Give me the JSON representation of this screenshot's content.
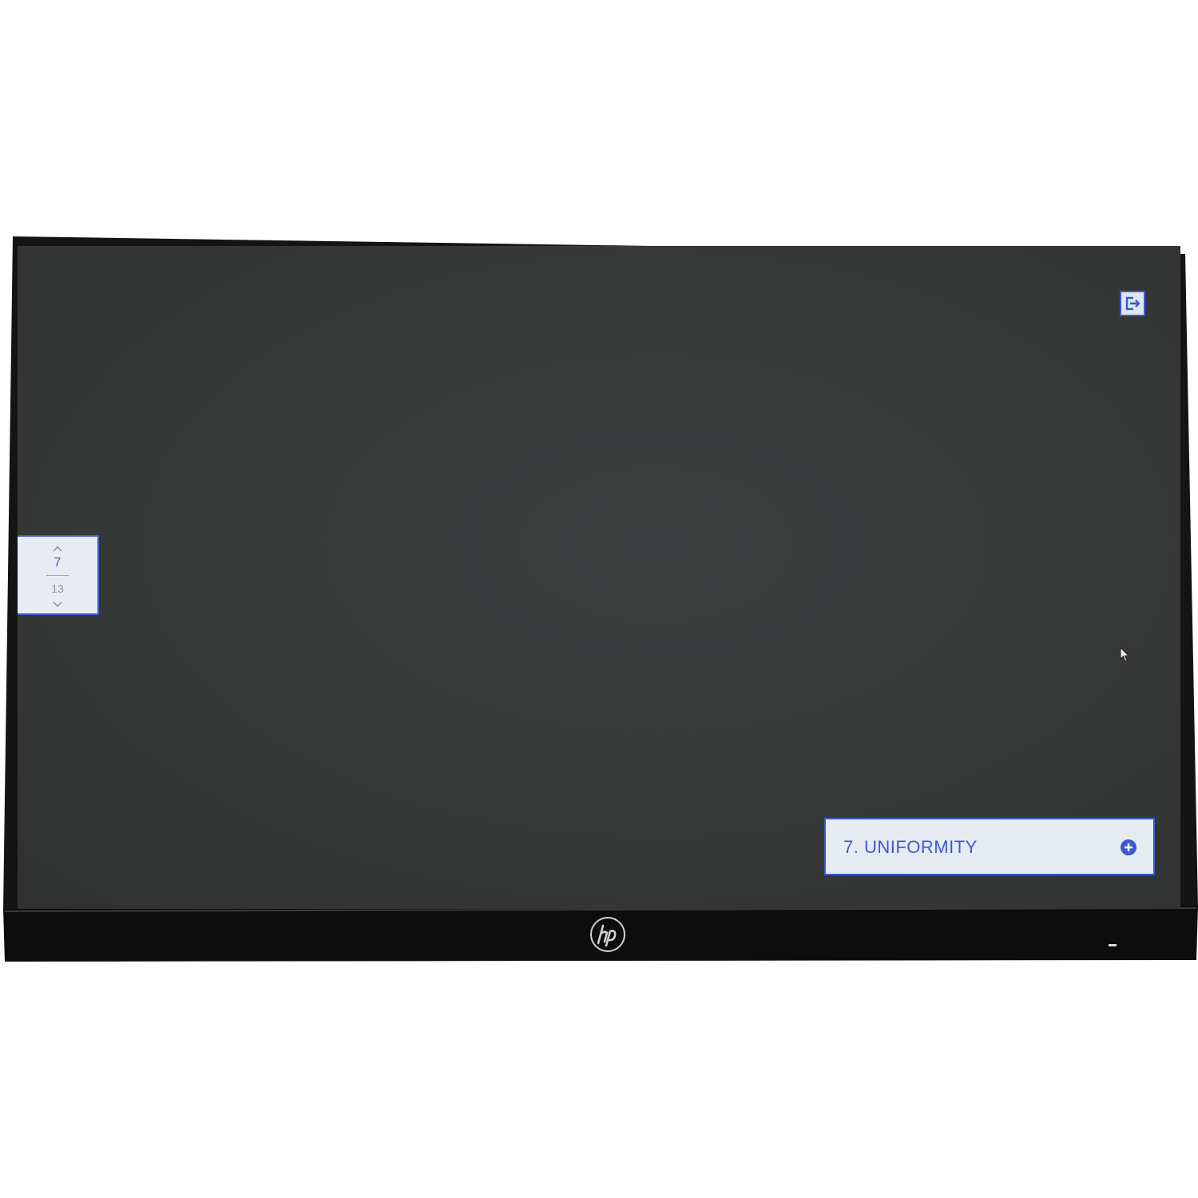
{
  "osd": {
    "pager": {
      "current": "7",
      "total": "13",
      "up_icon": "chevron-up-icon",
      "down_icon": "chevron-down-icon"
    },
    "exit_icon": "exit-icon",
    "item": {
      "label": "7. UNIFORMITY",
      "action_icon": "plus-circle-icon"
    }
  },
  "device": {
    "logo": "hp"
  },
  "colors": {
    "accent": "#3a5bd0",
    "panel_bg": "#e6ebf2",
    "screen_bg": "#363938",
    "bezel": "#111111"
  }
}
